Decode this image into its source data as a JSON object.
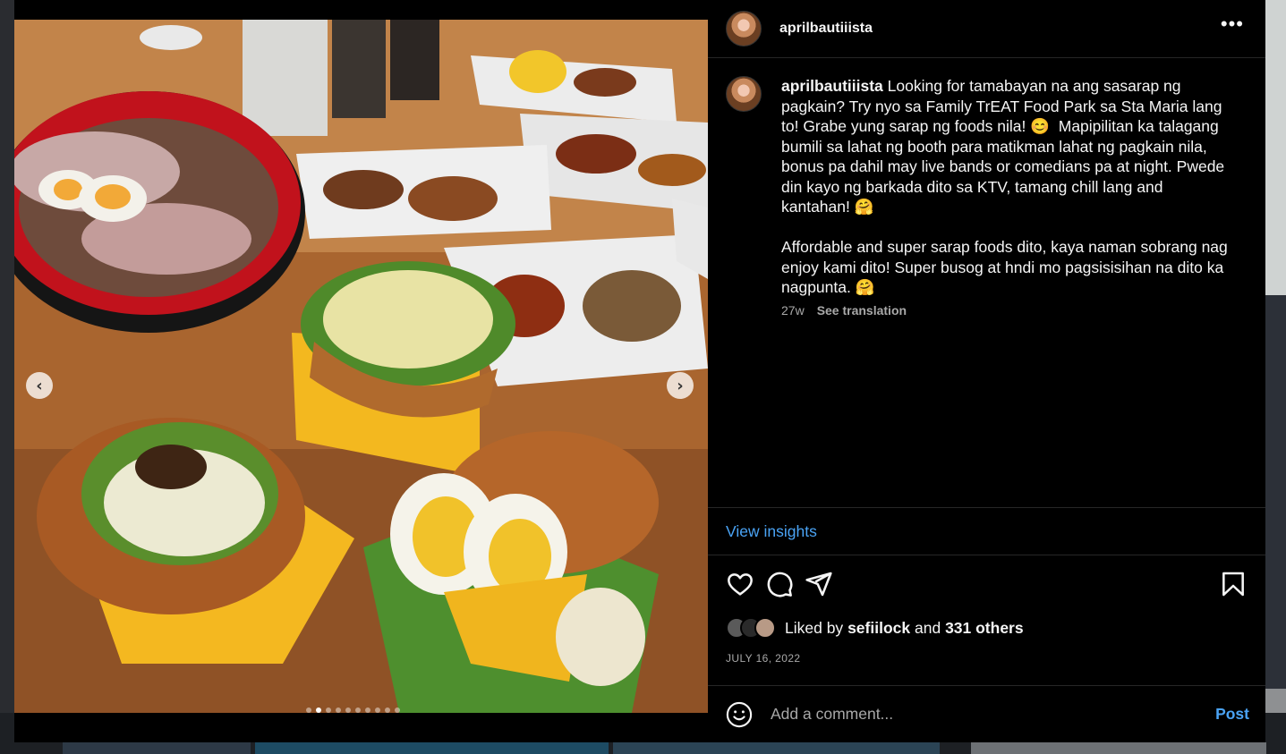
{
  "post": {
    "username": "aprilbautiiista",
    "more_icon": "more-horizontal-icon",
    "caption_para1": "Looking for tamabayan na ang sasarap ng pagkain? Try nyo sa Family TrEAT Food Park sa Sta Maria lang to! Grabe yung sarap ng foods nila! 😊  Mapipilitan ka talagang bumili sa lahat ng booth para matikman lahat ng pagkain nila, bonus pa dahil may live bands or comedians pa at night. Pwede din kayo ng barkada dito sa KTV, tamang chill lang and kantahan! 🤗",
    "caption_para2": "Affordable and super sarap foods dito, kaya naman sobrang nag enjoy kami dito! Super busog at hndi mo pagsisisihan na dito ka nagpunta. 🤗",
    "age": "27w",
    "see_translation": "See translation",
    "view_insights": "View insights",
    "likes": {
      "prefix": "Liked by",
      "user": "sefiilock",
      "conjunction": "and",
      "others": "331 others"
    },
    "date": "JULY 16, 2022",
    "comment_placeholder": "Add a comment...",
    "post_button": "Post",
    "carousel": {
      "total": 10,
      "active_index": 1
    }
  },
  "colors": {
    "link_blue": "#4aa3f4",
    "panel_bg": "#000000",
    "muted_text": "#a8a8a8"
  }
}
